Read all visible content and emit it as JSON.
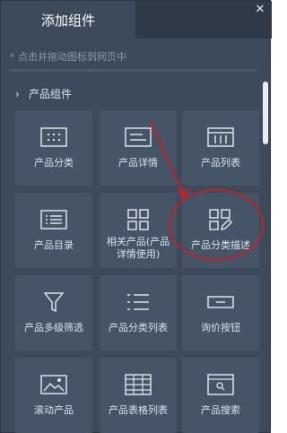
{
  "header": {
    "active_tab": "添加组件",
    "close_glyph": "✕"
  },
  "hint": "* 点击并拖动图标到网页中",
  "section": {
    "chevron": "›",
    "title": "产品组件"
  },
  "components": [
    {
      "label": "产品分类",
      "icon": "grid-dots-icon"
    },
    {
      "label": "产品详情",
      "icon": "detail-card-icon"
    },
    {
      "label": "产品列表",
      "icon": "columns-icon"
    },
    {
      "label": "产品目录",
      "icon": "list-card-icon"
    },
    {
      "label": "相关产品(产品详情使用)",
      "icon": "four-squares-icon"
    },
    {
      "label": "产品分类描述",
      "icon": "squares-edit-icon"
    },
    {
      "label": "产品多级筛选",
      "icon": "funnel-icon"
    },
    {
      "label": "产品分类列表",
      "icon": "bullet-list-icon"
    },
    {
      "label": "询价按钮",
      "icon": "button-icon"
    },
    {
      "label": "滚动产品",
      "icon": "image-icon"
    },
    {
      "label": "产品表格列表",
      "icon": "table-icon"
    },
    {
      "label": "产品搜索",
      "icon": "search-box-icon"
    }
  ],
  "colors": {
    "panel_bg": "#3c4a5b",
    "tile_bg": "#455466",
    "tab_bar": "#2e3a48",
    "annotation_red": "#b3262d"
  }
}
